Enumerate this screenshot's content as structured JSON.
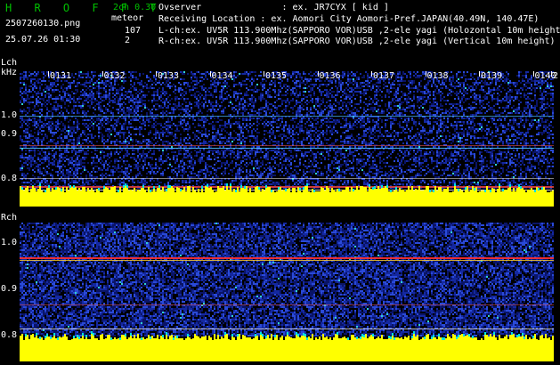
{
  "header": {
    "app_title": "H R O F F T",
    "mode": "2ch 0.30",
    "meteor_label": "meteor",
    "filename": "2507260130.png",
    "datetime": "25.07.26 01:30",
    "count_l": "107",
    "count_r": "2",
    "observer": "Ovserver               : ex. JR7CYX [ kid ]",
    "location": "Receiving Location : ex. Aomori City Aomori-Pref.JAPAN(40.49N, 140.47E)",
    "lch_info": "L-ch:ex. UV5R 113.900Mhz(SAPPORO VOR)USB ,2-ele yagi (Holozontal 10m height",
    "rch_info": "R-ch:ex. UV5R 113.900Mhz(SAPPORO VOR)USB ,2-ele yagi (Vertical 10m height)"
  },
  "left_panel": {
    "channel_label": "Lch",
    "unit_label": "kHz",
    "y_ticks": [
      "1.0",
      "0.9",
      "0.8"
    ]
  },
  "right_panel": {
    "channel_label": "Rch",
    "y_ticks": [
      "1.0",
      "0.9",
      "0.8"
    ]
  },
  "time_ticks": [
    "0131",
    "0132",
    "0133",
    "0134",
    "0135",
    "0136",
    "0137",
    "0138",
    "0139",
    "0140",
    "2"
  ],
  "colors": {
    "background": "#000000",
    "title_green": "#00c000",
    "noise_blue": "#1020a0",
    "signal_yellow": "#ffff00",
    "signal_cyan": "#00e0e0",
    "line_red": "#ff3030"
  }
}
